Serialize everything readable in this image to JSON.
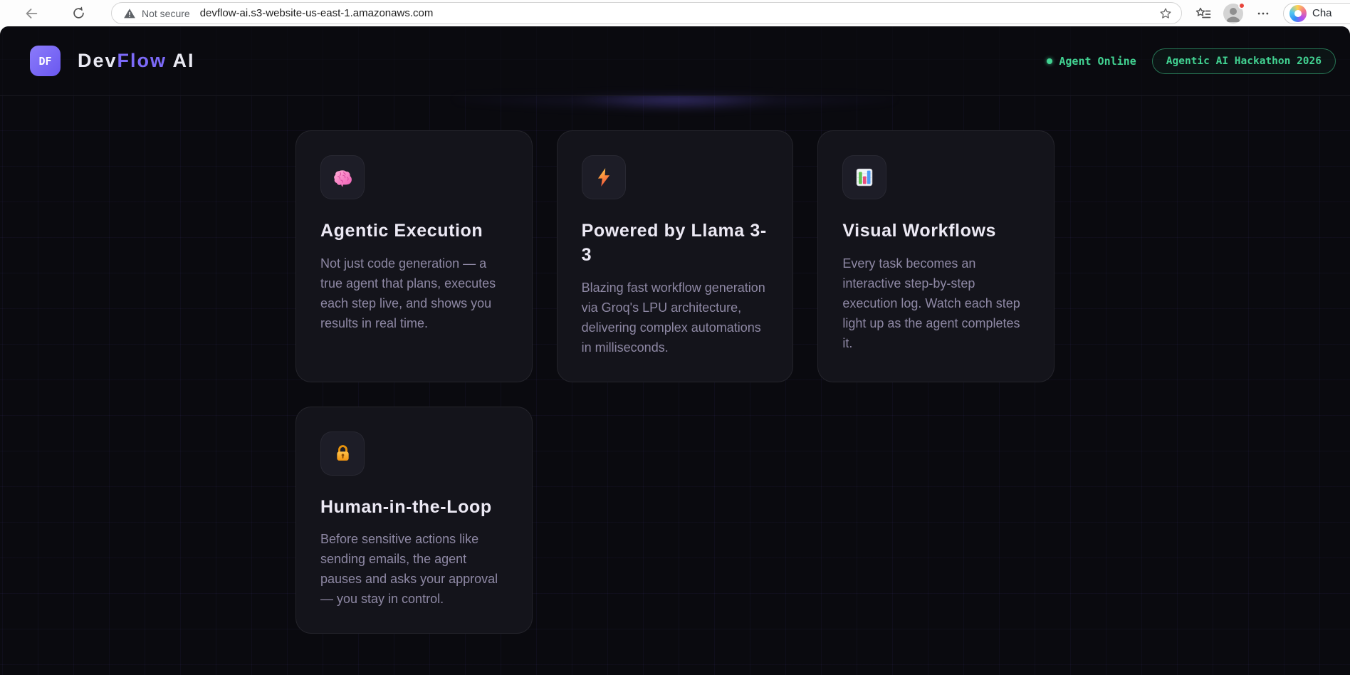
{
  "browser": {
    "security_label": "Not secure",
    "url": "devflow-ai.s3-website-us-east-1.amazonaws.com",
    "copilot_label": "Cha"
  },
  "header": {
    "logo_text": "DF",
    "brand_dev": "Dev",
    "brand_flow": "Flow",
    "brand_ai": " AI",
    "status_label": "Agent Online",
    "badge_label": "Agentic AI Hackathon 2026"
  },
  "colors": {
    "accent_purple": "#7c6af8",
    "accent_green": "#42d392",
    "page_bg": "#0a0a0f",
    "card_bg": "#14141b",
    "card_title_text": "#ece9f4",
    "card_body_text": "#8e88a4"
  },
  "cards": [
    {
      "icon": "brain-icon",
      "title": "Agentic Execution",
      "body": "Not just code generation — a true agent that plans, executes each step live, and shows you results in real time."
    },
    {
      "icon": "lightning-icon",
      "title": "Powered by Llama 3-3",
      "body": "Blazing fast workflow generation via Groq's LPU architecture, delivering complex automations in milliseconds."
    },
    {
      "icon": "bar-chart-icon",
      "title": "Visual Workflows",
      "body": "Every task becomes an interactive step-by-step execution log. Watch each step light up as the agent completes it."
    },
    {
      "icon": "lock-icon",
      "title": "Human-in-the-Loop",
      "body": "Before sensitive actions like sending emails, the agent pauses and asks your approval — you stay in control."
    }
  ]
}
